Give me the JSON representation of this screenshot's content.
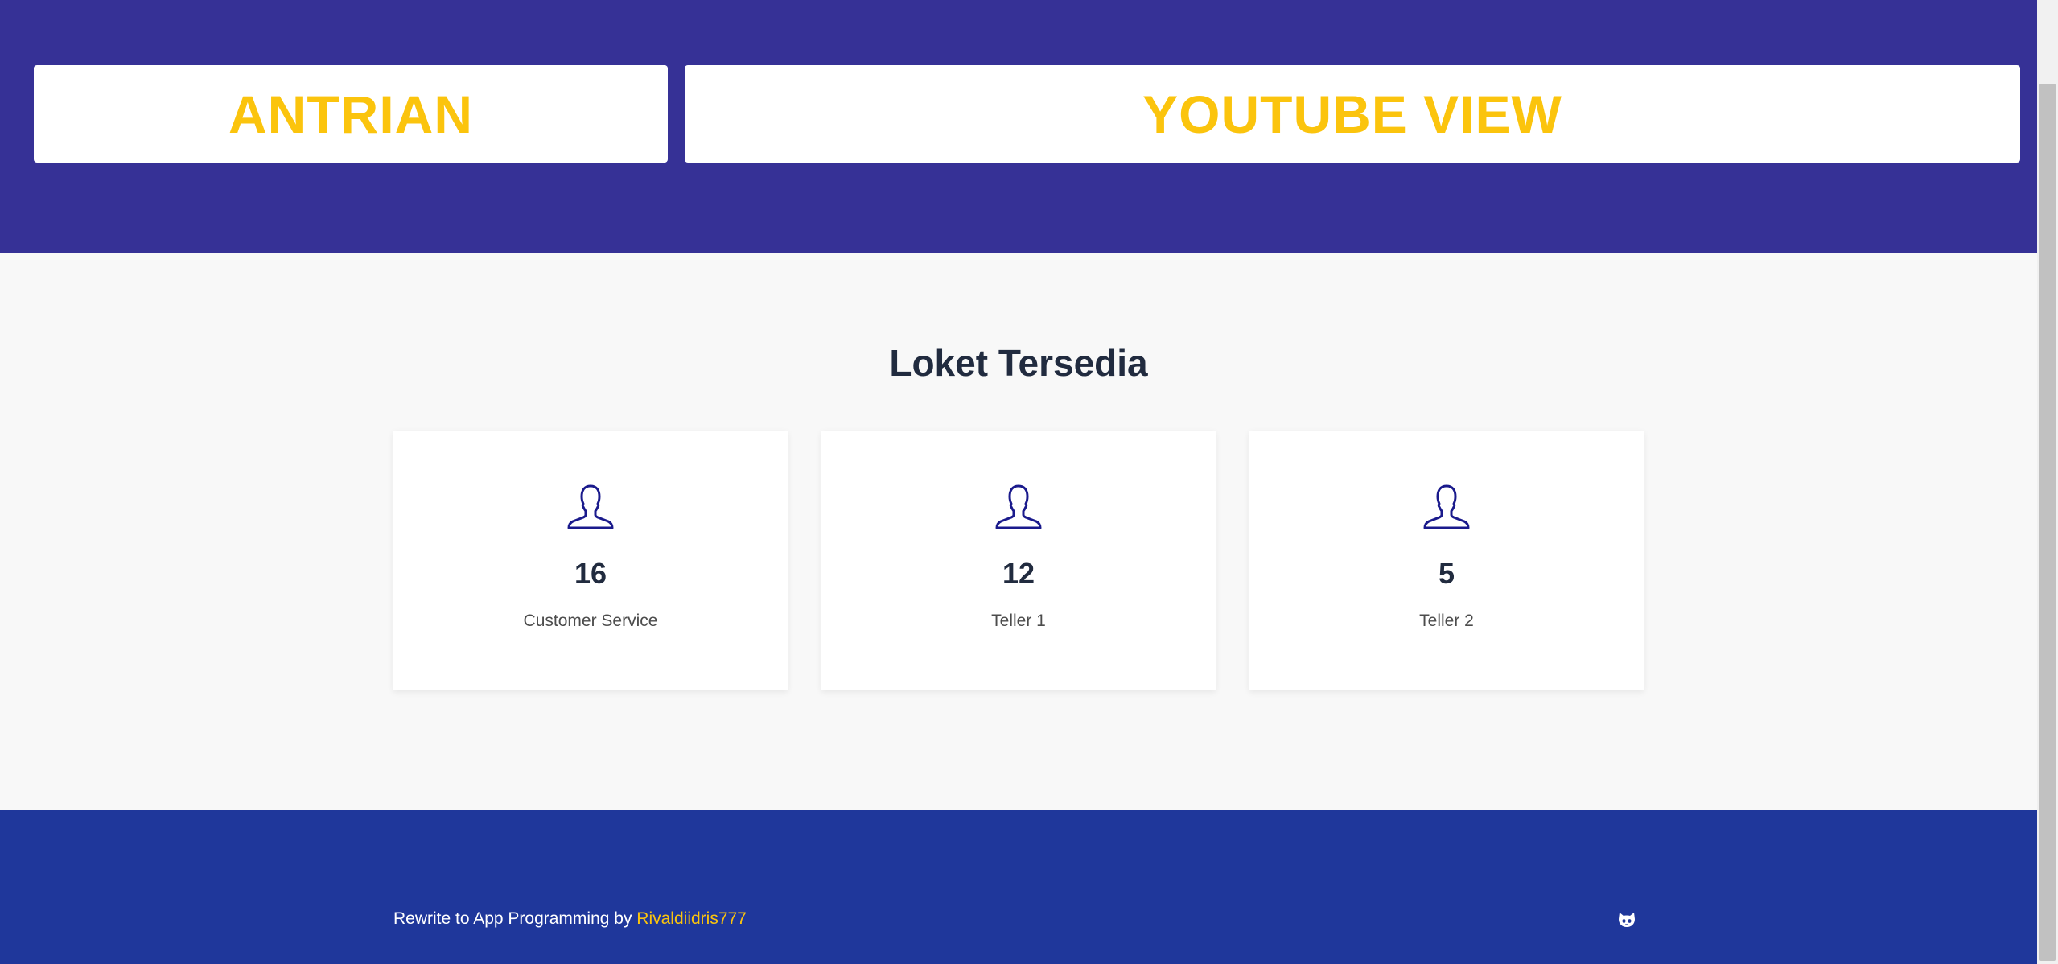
{
  "header": {
    "left_title": "ANTRIAN",
    "right_title": "YOUTUBE VIEW"
  },
  "main": {
    "title": "Loket Tersedia",
    "counters": [
      {
        "number": "16",
        "label": "Customer Service",
        "icon": "user-icon"
      },
      {
        "number": "12",
        "label": "Teller 1",
        "icon": "user-icon"
      },
      {
        "number": "5",
        "label": "Teller 2",
        "icon": "user-icon"
      }
    ]
  },
  "footer": {
    "prefix": "Rewrite to App Programming by ",
    "author_link": "Rivaldiidris777",
    "icon": "github-icon"
  },
  "colors": {
    "header_bg": "#363196",
    "accent": "#fbc40d",
    "footer_bg": "#1f379b",
    "icon_stroke": "#1a1a8c"
  }
}
